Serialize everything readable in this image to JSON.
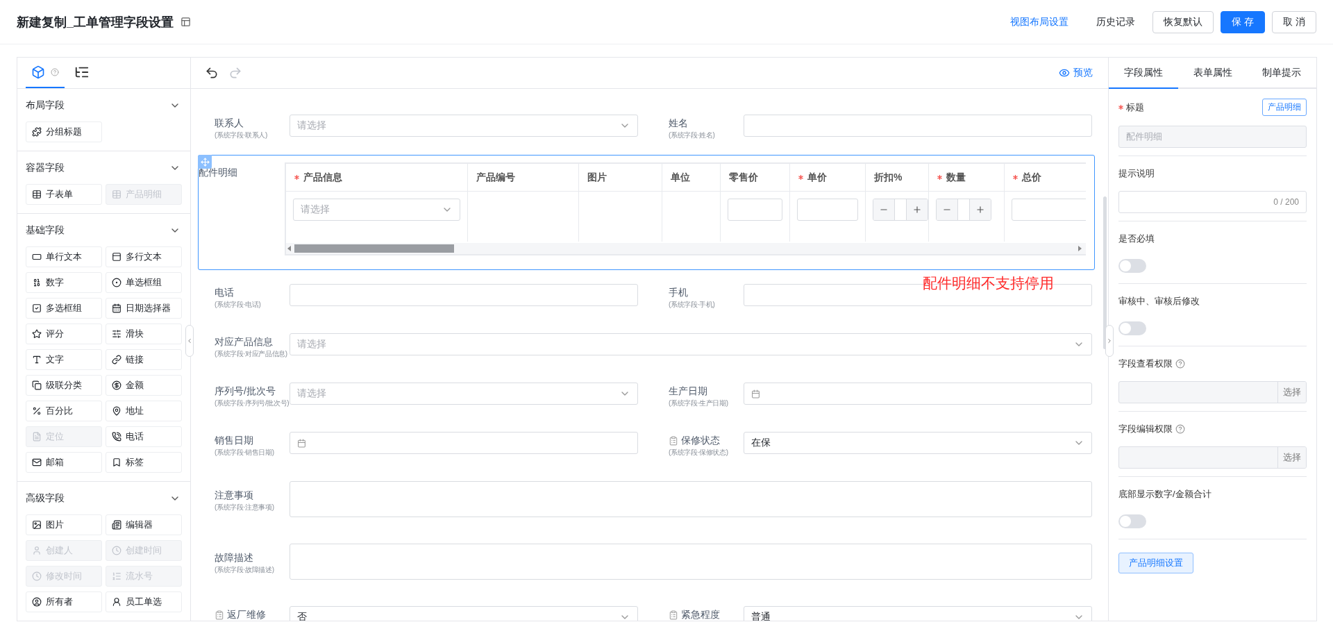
{
  "header": {
    "title": "新建复制_工单管理字段设置",
    "actions": [
      {
        "label": "视图布局设置",
        "kind": "link"
      },
      {
        "label": "历史记录",
        "kind": "text"
      },
      {
        "label": "恢复默认",
        "kind": "default"
      },
      {
        "label": "保 存",
        "kind": "primary"
      },
      {
        "label": "取 消",
        "kind": "default"
      }
    ]
  },
  "toolbox": {
    "tabs": [
      {
        "kind": "components",
        "selected": true
      },
      {
        "kind": "outline",
        "selected": false
      }
    ],
    "sections": [
      {
        "title": "布局字段",
        "expanded": true,
        "items": [
          {
            "label": "分组标题",
            "disabled": false
          }
        ]
      },
      {
        "title": "容器字段",
        "expanded": true,
        "items": [
          {
            "label": "子表单",
            "disabled": false
          },
          {
            "label": "产品明细",
            "disabled": true
          }
        ]
      },
      {
        "title": "基础字段",
        "expanded": true,
        "items": [
          {
            "label": "单行文本",
            "disabled": false
          },
          {
            "label": "多行文本",
            "disabled": false
          },
          {
            "label": "数字",
            "disabled": false
          },
          {
            "label": "单选框组",
            "disabled": false
          },
          {
            "label": "多选框组",
            "disabled": false
          },
          {
            "label": "日期选择器",
            "disabled": false
          },
          {
            "label": "评分",
            "disabled": false
          },
          {
            "label": "滑块",
            "disabled": false
          },
          {
            "label": "文字",
            "disabled": false
          },
          {
            "label": "链接",
            "disabled": false
          },
          {
            "label": "级联分类",
            "disabled": false
          },
          {
            "label": "金额",
            "disabled": false
          },
          {
            "label": "百分比",
            "disabled": false
          },
          {
            "label": "地址",
            "disabled": false
          },
          {
            "label": "定位",
            "disabled": true
          },
          {
            "label": "电话",
            "disabled": false
          },
          {
            "label": "邮箱",
            "disabled": false
          },
          {
            "label": "标签",
            "disabled": false
          }
        ]
      },
      {
        "title": "高级字段",
        "expanded": true,
        "items": [
          {
            "label": "图片",
            "disabled": false
          },
          {
            "label": "编辑器",
            "disabled": false
          },
          {
            "label": "创建人",
            "disabled": true
          },
          {
            "label": "创建时间",
            "disabled": true
          },
          {
            "label": "修改时间",
            "disabled": true
          },
          {
            "label": "流水号",
            "disabled": true
          },
          {
            "label": "所有者",
            "disabled": false
          },
          {
            "label": "员工单选",
            "disabled": false
          }
        ]
      }
    ]
  },
  "canvas": {
    "toolbar": [
      {
        "kind": "undo",
        "disabled": false
      },
      {
        "kind": "redo",
        "disabled": true
      }
    ],
    "preview": "预览",
    "rows": [
      {
        "fields": [
          {
            "label": "联系人",
            "hint": "(系统字段·联系人)",
            "kind": "select",
            "placeholder": "请选择",
            "locked": false
          },
          {
            "label": "姓名",
            "hint": "(系统字段·姓名)",
            "kind": "input",
            "locked": false
          }
        ]
      },
      {
        "fields": [
          {
            "label": "配件明细",
            "kind": "table",
            "selected": true,
            "locked": false
          }
        ]
      },
      {
        "fields": [
          {
            "label": "电话",
            "hint": "(系统字段·电话)",
            "kind": "input",
            "locked": false
          },
          {
            "label": "手机",
            "hint": "(系统字段·手机)",
            "kind": "input",
            "locked": false
          }
        ]
      },
      {
        "fields": [
          {
            "label": "对应产品信息",
            "hint": "(系统字段·对应产品信息)",
            "kind": "select",
            "placeholder": "请选择",
            "locked": false
          }
        ]
      },
      {
        "fields": [
          {
            "label": "序列号/批次号",
            "hint": "(系统字段·序列号/批次号)",
            "kind": "select",
            "placeholder": "请选择",
            "locked": false
          },
          {
            "label": "生产日期",
            "hint": "(系统字段·生产日期)",
            "kind": "date",
            "locked": false
          }
        ]
      },
      {
        "fields": [
          {
            "label": "销售日期",
            "hint": "(系统字段·销售日期)",
            "kind": "date",
            "locked": false
          },
          {
            "label": "保修状态",
            "hint": "(系统字段·保修状态)",
            "kind": "select",
            "value": "在保",
            "locked": true
          }
        ]
      },
      {
        "fields": [
          {
            "label": "注意事项",
            "hint": "(系统字段·注意事项)",
            "kind": "textarea",
            "locked": false
          }
        ]
      },
      {
        "fields": [
          {
            "label": "故障描述",
            "hint": "(系统字段·故障描述)",
            "kind": "textarea",
            "locked": false
          }
        ]
      },
      {
        "fields": [
          {
            "label": "返厂维修",
            "kind": "select",
            "value": "否",
            "locked": true
          },
          {
            "label": "紧急程度",
            "kind": "select",
            "value": "普通",
            "locked": true
          }
        ]
      }
    ],
    "table": {
      "columns": [
        {
          "label": "产品信息",
          "required": true,
          "kind": "select",
          "placeholder": "请选择"
        },
        {
          "label": "产品编号",
          "required": false,
          "kind": "empty"
        },
        {
          "label": "图片",
          "required": false,
          "kind": "empty"
        },
        {
          "label": "单位",
          "required": false,
          "kind": "empty"
        },
        {
          "label": "零售价",
          "required": false,
          "kind": "input"
        },
        {
          "label": "单价",
          "required": true,
          "kind": "input"
        },
        {
          "label": "折扣%",
          "required": false,
          "kind": "stepper"
        },
        {
          "label": "数量",
          "required": true,
          "kind": "stepper"
        },
        {
          "label": "总价",
          "required": true,
          "kind": "input"
        }
      ]
    },
    "annotation": "配件明细不支持停用"
  },
  "properties": {
    "tabs": [
      {
        "label": "字段属性",
        "selected": true
      },
      {
        "label": "表单属性",
        "selected": false
      },
      {
        "label": "制单提示",
        "selected": false
      }
    ],
    "items": [
      {
        "kind": "title",
        "label": "标题",
        "required": true,
        "tag": "产品明细",
        "value": "配件明细"
      },
      {
        "kind": "textarea",
        "label": "提示说明",
        "counter": "0 / 200"
      },
      {
        "kind": "switch",
        "label": "是否必填",
        "on": false
      },
      {
        "kind": "switch",
        "label": "审核中、审核后修改",
        "on": false
      },
      {
        "kind": "picker",
        "label": "字段查看权限",
        "button": "选择"
      },
      {
        "kind": "picker",
        "label": "字段编辑权限",
        "button": "选择"
      },
      {
        "kind": "switch",
        "label": "底部显示数字/金额合计",
        "on": false
      },
      {
        "kind": "button",
        "label": "产品明细设置"
      }
    ]
  }
}
